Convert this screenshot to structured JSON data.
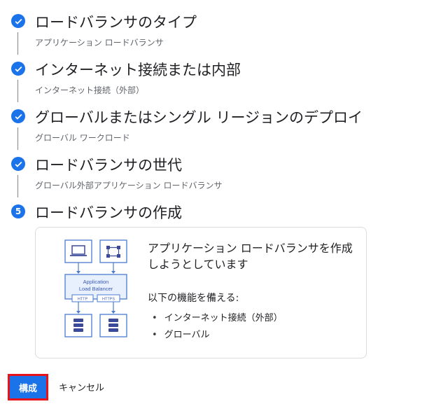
{
  "steps": [
    {
      "title": "ロードバランサのタイプ",
      "subtitle": "アプリケーション ロードバランサ",
      "status": "done"
    },
    {
      "title": "インターネット接続または内部",
      "subtitle": "インターネット接続（外部）",
      "status": "done"
    },
    {
      "title": "グローバルまたはシングル リージョンのデプロイ",
      "subtitle": "グローバル ワークロード",
      "status": "done"
    },
    {
      "title": "ロードバランサの世代",
      "subtitle": "グローバル外部アプリケーション ロードバランサ",
      "status": "done"
    },
    {
      "title": "ロードバランサの作成",
      "number": "5",
      "status": "active"
    }
  ],
  "card": {
    "title": "アプリケーション ロードバランサを作成しようとしています",
    "features_heading": "以下の機能を備える:",
    "features": [
      "インターネット接続（外部）",
      "グローバル"
    ],
    "diagram": {
      "lb_line1": "Application",
      "lb_line2": "Load Balancer",
      "protocol1": "HTTP",
      "protocol2": "HTTPS"
    }
  },
  "actions": {
    "configure_label": "構成",
    "cancel_label": "キャンセル"
  },
  "colors": {
    "accent": "#1a73e8",
    "highlight": "#e8121a"
  }
}
